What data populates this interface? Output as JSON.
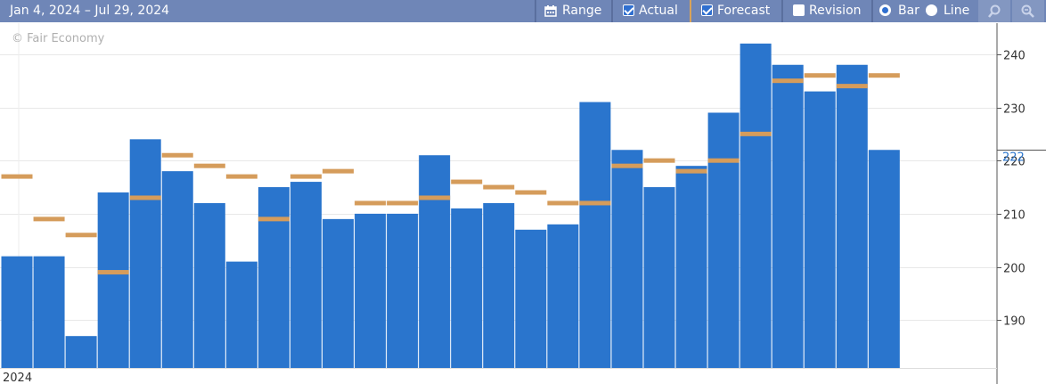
{
  "toolbar": {
    "date_range": "Jan 4, 2024 – Jul 29, 2024",
    "range_label": "Range",
    "actual_label": "Actual",
    "forecast_label": "Forecast",
    "revision_label": "Revision",
    "bar_label": "Bar",
    "line_label": "Line",
    "actual_checked": true,
    "forecast_checked": true,
    "revision_checked": false,
    "mode": "bar",
    "icons": [
      "calendar-icon",
      "zoom-in-icon",
      "zoom-out-icon"
    ]
  },
  "watermark": "© Fair Economy",
  "colors": {
    "toolbar_bg": "#6f86b7",
    "bar": "#2a75cd",
    "forecast": "#d59c5b",
    "current_label": "#2a75cd"
  },
  "chart_data": {
    "type": "bar",
    "x_axis_label": "2024",
    "ylim": [
      181,
      246
    ],
    "y_ticks": [
      190,
      200,
      210,
      220,
      230,
      240
    ],
    "y_tick_labels": [
      "190",
      "200",
      "210",
      "220",
      "230",
      "240"
    ],
    "current_value_label": "222",
    "grid": true,
    "series": [
      {
        "name": "Actual",
        "values": [
          202,
          202,
          187,
          214,
          224,
          218,
          212,
          201,
          215,
          216,
          209,
          210,
          210,
          221,
          211,
          212,
          207,
          208,
          231,
          222,
          215,
          219,
          229,
          242,
          238,
          233,
          238,
          222
        ]
      },
      {
        "name": "Forecast",
        "values": [
          217,
          209,
          206,
          199,
          213,
          221,
          219,
          217,
          209,
          217,
          218,
          212,
          212,
          213,
          216,
          215,
          214,
          212,
          212,
          219,
          220,
          218,
          220,
          225,
          235,
          236,
          234,
          236
        ]
      }
    ]
  }
}
